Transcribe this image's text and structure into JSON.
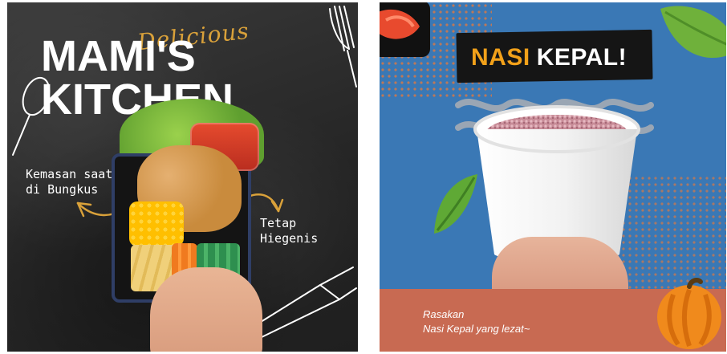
{
  "left_poster": {
    "script_title": "Delicious",
    "main_title": "MAMI'S KITCHEN",
    "note_left_line1": "Kemasan saat",
    "note_left_line2": "di Bungkus",
    "note_right_line1": "Tetap",
    "note_right_line2": "Hiegenis",
    "colors": {
      "background": "#2b2b2b",
      "accent_script": "#d9a13a",
      "arrow": "#d9a13a",
      "text": "#ffffff",
      "tray_border": "#2f3e66"
    },
    "icons": [
      "spoon-icon",
      "fork-icon",
      "knife-icon",
      "arrow-left-icon",
      "arrow-right-icon"
    ]
  },
  "right_poster": {
    "title_part1": "NASI",
    "title_part2": "KEPAL!",
    "caption_line1": "Rasakan",
    "caption_line2": "Nasi Kepal yang lezat~",
    "colors": {
      "background": "#3a78b5",
      "bottom_band": "#c86a52",
      "title_accent": "#f2a11a",
      "title_plate": "#151515",
      "dots": "#ff7a2b"
    },
    "icons": [
      "leaf-icon",
      "wave-icon",
      "cup-icon",
      "pumpkin-icon"
    ]
  }
}
